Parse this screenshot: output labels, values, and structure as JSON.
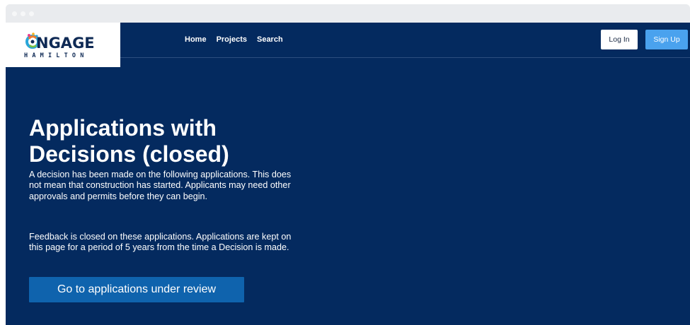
{
  "logo": {
    "text": "NGAGE",
    "subtext": "HAMILTON"
  },
  "nav": {
    "links": [
      "Home",
      "Projects",
      "Search"
    ],
    "login_label": "Log In",
    "signup_label": "Sign Up"
  },
  "hero": {
    "title": "Applications with Decisions (closed)",
    "paragraph1": "A decision has been made on the following applications. This does not mean that construction has started. Applicants may need other approvals and permits before they can begin.",
    "paragraph2": "Feedback is closed on these applications. Applications are kept on this page for a period of 5 years from the time a Decision is made.",
    "cta_label": "Go to applications under review"
  },
  "colors": {
    "background": "#042a5f",
    "signup": "#4aa2ee",
    "cta": "#0f63ad"
  }
}
